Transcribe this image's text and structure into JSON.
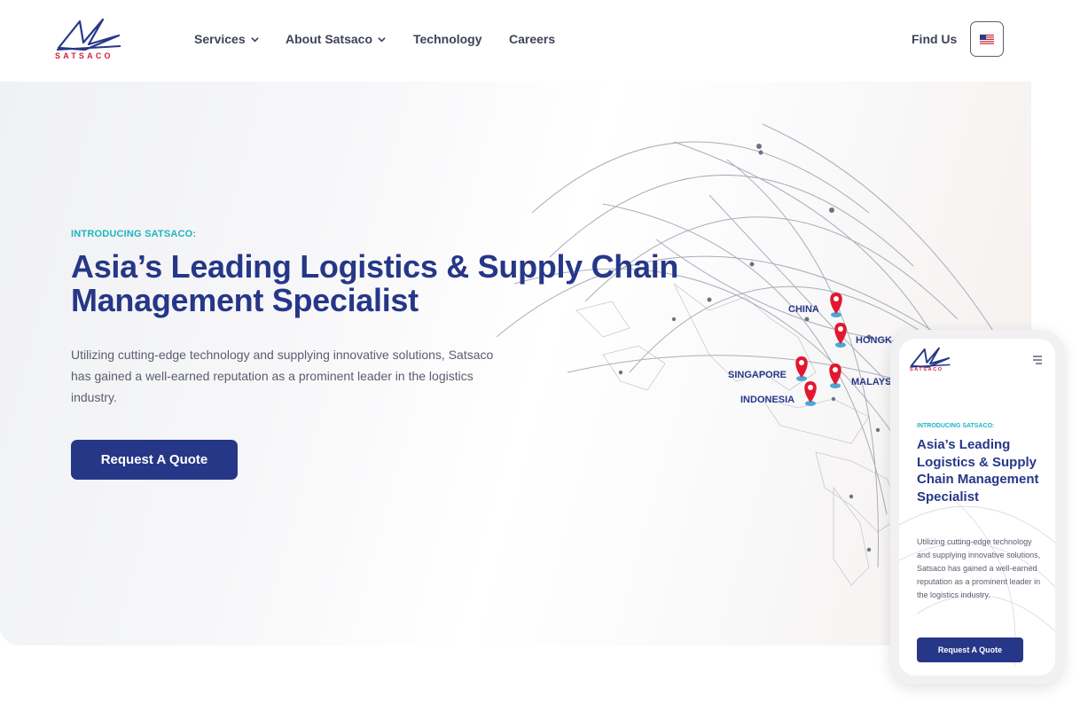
{
  "brand": {
    "name": "SATSACO"
  },
  "nav": {
    "items": [
      {
        "label": "Services",
        "has_dropdown": true
      },
      {
        "label": "About Satsaco",
        "has_dropdown": true
      },
      {
        "label": "Technology",
        "has_dropdown": false
      },
      {
        "label": "Careers",
        "has_dropdown": false
      }
    ],
    "find_us": "Find Us",
    "language_flag": "us-flag-icon"
  },
  "hero": {
    "eyebrow": "INTRODUCING SATSACO:",
    "title": "Asia’s Leading Logistics & Supply Chain Management Specialist",
    "description": "Utilizing cutting-edge technology and supplying innovative solutions, Satsaco has gained a well-earned reputation as a prominent leader in the logistics industry.",
    "cta_label": "Request A Quote"
  },
  "map_locations": [
    "CHINA",
    "HONGK",
    "SINGAPORE",
    "MALAYS",
    "INDONESIA"
  ],
  "mobile": {
    "eyebrow": "INTRODUCING SATSACO:",
    "title": "Asia’s Leading Logistics & Supply Chain Management Specialist",
    "description": "Utilizing cutting-edge technology and supplying innovative solutions, Satsaco has gained a well-earned reputation as a prominent leader in the logistics industry.",
    "cta_label": "Request A Quote"
  },
  "colors": {
    "primary": "#263788",
    "accent": "#1eb5c0",
    "brand_red": "#d21f3c",
    "text": "#5a5d6e"
  }
}
